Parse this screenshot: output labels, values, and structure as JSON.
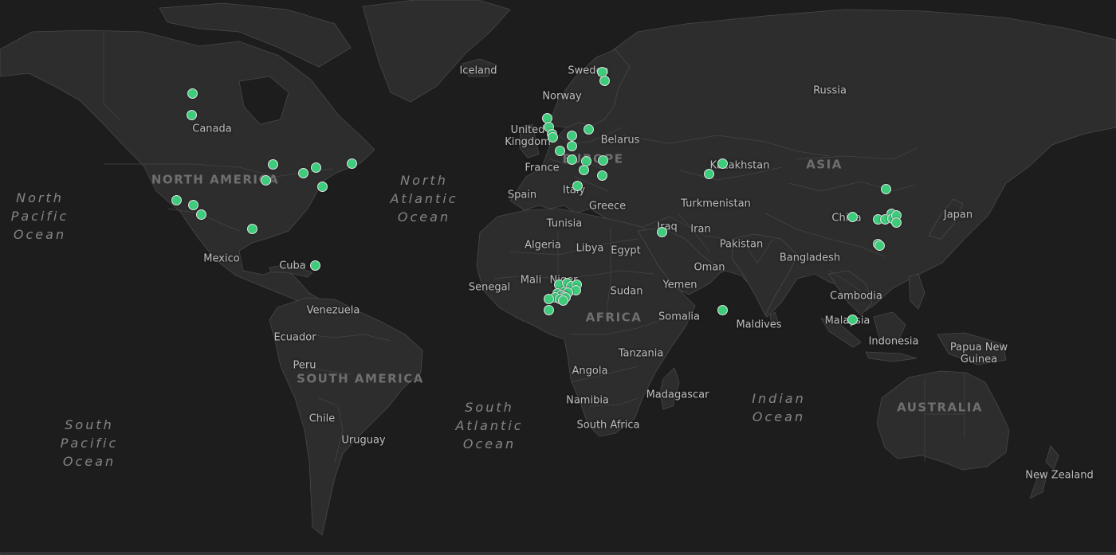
{
  "map": {
    "basemap": "dark",
    "colors": {
      "background": "#1d1d1d",
      "land": "#2d2d2d",
      "border": "#454545",
      "marker_fill": "#3ecb7c",
      "marker_stroke": "#e6e6e6"
    }
  },
  "labels": {
    "oceans": [
      {
        "id": "north-pacific",
        "text": "North\nPacific\nOcean"
      },
      {
        "id": "north-atlantic",
        "text": "North\nAtlantic\nOcean"
      },
      {
        "id": "south-atlantic",
        "text": "South\nAtlantic\nOcean"
      },
      {
        "id": "south-pacific",
        "text": "South\nPacific\nOcean"
      },
      {
        "id": "indian",
        "text": "Indian\nOcean"
      }
    ],
    "continents": [
      {
        "id": "north-america",
        "text": "NORTH\nAMERICA"
      },
      {
        "id": "south-america",
        "text": "SOUTH\nAMERICA"
      },
      {
        "id": "europe",
        "text": "EUROPE"
      },
      {
        "id": "africa",
        "text": "AFRICA"
      },
      {
        "id": "asia",
        "text": "ASIA"
      },
      {
        "id": "australia",
        "text": "AUSTRALIA"
      }
    ],
    "places": [
      {
        "id": "canada",
        "text": "Canada"
      },
      {
        "id": "mexico",
        "text": "Mexico"
      },
      {
        "id": "cuba",
        "text": "Cuba"
      },
      {
        "id": "venezuela",
        "text": "Venezuela"
      },
      {
        "id": "ecuador",
        "text": "Ecuador"
      },
      {
        "id": "peru",
        "text": "Peru"
      },
      {
        "id": "chile",
        "text": "Chile"
      },
      {
        "id": "uruguay",
        "text": "Uruguay"
      },
      {
        "id": "iceland",
        "text": "Iceland"
      },
      {
        "id": "sweden",
        "text": "Sweden"
      },
      {
        "id": "norway",
        "text": "Norway"
      },
      {
        "id": "united-kingdom",
        "text": "United\nKingdom"
      },
      {
        "id": "belarus",
        "text": "Belarus"
      },
      {
        "id": "france",
        "text": "France"
      },
      {
        "id": "spain",
        "text": "Spain"
      },
      {
        "id": "italy",
        "text": "Italy"
      },
      {
        "id": "greece",
        "text": "Greece"
      },
      {
        "id": "russia",
        "text": "Russia"
      },
      {
        "id": "kazakhstan",
        "text": "Kazakhstan"
      },
      {
        "id": "turkmenistan",
        "text": "Turkmenistan"
      },
      {
        "id": "iraq",
        "text": "Iraq"
      },
      {
        "id": "iran",
        "text": "Iran"
      },
      {
        "id": "pakistan",
        "text": "Pakistan"
      },
      {
        "id": "china",
        "text": "China"
      },
      {
        "id": "japan",
        "text": "Japan"
      },
      {
        "id": "bangladesh",
        "text": "Bangladesh"
      },
      {
        "id": "oman",
        "text": "Oman"
      },
      {
        "id": "yemen",
        "text": "Yemen"
      },
      {
        "id": "tunisia",
        "text": "Tunisia"
      },
      {
        "id": "algeria",
        "text": "Algeria"
      },
      {
        "id": "libya",
        "text": "Libya"
      },
      {
        "id": "egypt",
        "text": "Egypt"
      },
      {
        "id": "senegal",
        "text": "Senegal"
      },
      {
        "id": "mali",
        "text": "Mali"
      },
      {
        "id": "niger",
        "text": "Niger"
      },
      {
        "id": "sudan",
        "text": "Sudan"
      },
      {
        "id": "somalia",
        "text": "Somalia"
      },
      {
        "id": "tanzania",
        "text": "Tanzania"
      },
      {
        "id": "angola",
        "text": "Angola"
      },
      {
        "id": "namibia",
        "text": "Namibia"
      },
      {
        "id": "madagascar",
        "text": "Madagascar"
      },
      {
        "id": "south-africa",
        "text": "South Africa"
      },
      {
        "id": "maldives",
        "text": "Maldives"
      },
      {
        "id": "cambodia",
        "text": "Cambodia"
      },
      {
        "id": "malaysia",
        "text": "Malaysia"
      },
      {
        "id": "indonesia",
        "text": "Indonesia"
      },
      {
        "id": "papua-new-guinea",
        "text": "Papua New\nGuinea"
      },
      {
        "id": "new-zealand",
        "text": "New Zealand"
      }
    ]
  },
  "markers": [
    {
      "region": "north-america",
      "lon": -116.5,
      "lat": 60.3
    },
    {
      "region": "north-america",
      "lon": -116.7,
      "lat": 56.5
    },
    {
      "region": "north-america",
      "lon": -90.2,
      "lat": 46.2
    },
    {
      "region": "north-america",
      "lon": -92.6,
      "lat": 42.4
    },
    {
      "region": "north-america",
      "lon": -80.2,
      "lat": 44.1
    },
    {
      "region": "north-america",
      "lon": -76.1,
      "lat": 45.5
    },
    {
      "region": "north-america",
      "lon": -73.9,
      "lat": 40.7
    },
    {
      "region": "north-america",
      "lon": -64.4,
      "lat": 46.3
    },
    {
      "region": "north-america",
      "lon": -121.8,
      "lat": 37.3
    },
    {
      "region": "north-america",
      "lon": -116.4,
      "lat": 35.9
    },
    {
      "region": "north-america",
      "lon": -113.7,
      "lat": 33.4
    },
    {
      "region": "north-america",
      "lon": -96.9,
      "lat": 29.3
    },
    {
      "region": "north-america",
      "lon": -76.3,
      "lat": 17.9
    },
    {
      "region": "europe",
      "lon": -0.3,
      "lat": 55.9
    },
    {
      "region": "europe",
      "lon": 0.2,
      "lat": 54.2
    },
    {
      "region": "europe",
      "lon": 1.1,
      "lat": 52.7
    },
    {
      "region": "europe",
      "lon": 1.5,
      "lat": 52.1
    },
    {
      "region": "europe",
      "lon": 3.8,
      "lat": 49.2
    },
    {
      "region": "europe",
      "lon": 7.7,
      "lat": 52.4
    },
    {
      "region": "europe",
      "lon": 7.8,
      "lat": 50.2
    },
    {
      "region": "europe",
      "lon": 7.6,
      "lat": 47.3
    },
    {
      "region": "europe",
      "lon": 13.1,
      "lat": 53.7
    },
    {
      "region": "europe",
      "lon": 17.6,
      "lat": 63.6
    },
    {
      "region": "europe",
      "lon": 18.4,
      "lat": 62.3
    },
    {
      "region": "europe",
      "lon": 12.3,
      "lat": 47.0
    },
    {
      "region": "europe",
      "lon": 17.9,
      "lat": 47.2
    },
    {
      "region": "europe",
      "lon": 11.6,
      "lat": 44.9
    },
    {
      "region": "europe",
      "lon": 17.7,
      "lat": 43.6
    },
    {
      "region": "europe",
      "lon": 9.6,
      "lat": 41.0
    },
    {
      "region": "middle-east",
      "lon": 37.1,
      "lat": 28.4
    },
    {
      "region": "asia",
      "lon": 57.1,
      "lat": 46.4
    },
    {
      "region": "asia",
      "lon": 52.7,
      "lat": 43.9
    },
    {
      "region": "asia",
      "lon": 56.9,
      "lat": 3.4
    },
    {
      "region": "asia",
      "lon": 110.5,
      "lat": 40.2
    },
    {
      "region": "asia",
      "lon": 99.6,
      "lat": 32.7
    },
    {
      "region": "asia",
      "lon": 108.0,
      "lat": 31.9
    },
    {
      "region": "asia",
      "lon": 110.3,
      "lat": 32.1
    },
    {
      "region": "asia",
      "lon": 112.3,
      "lat": 33.5
    },
    {
      "region": "asia",
      "lon": 112.5,
      "lat": 32.3
    },
    {
      "region": "asia",
      "lon": 113.9,
      "lat": 33.1
    },
    {
      "region": "asia",
      "lon": 113.9,
      "lat": 31.0
    },
    {
      "region": "asia",
      "lon": 108.0,
      "lat": 24.6
    },
    {
      "region": "asia",
      "lon": 108.5,
      "lat": 24.3
    },
    {
      "region": "asia",
      "lon": 99.5,
      "lat": 0.2
    },
    {
      "region": "africa",
      "lon": 3.5,
      "lat": 11.9
    },
    {
      "region": "africa",
      "lon": 6.2,
      "lat": 12.3
    },
    {
      "region": "africa",
      "lon": 7.5,
      "lat": 11.2
    },
    {
      "region": "africa",
      "lon": 9.2,
      "lat": 11.9
    },
    {
      "region": "africa",
      "lon": 9.1,
      "lat": 10.0
    },
    {
      "region": "africa",
      "lon": 5.4,
      "lat": 9.4
    },
    {
      "region": "africa",
      "lon": 6.3,
      "lat": 9.2
    },
    {
      "region": "africa",
      "lon": 3.1,
      "lat": 8.9
    },
    {
      "region": "africa",
      "lon": 4.2,
      "lat": 8.4
    },
    {
      "region": "africa",
      "lon": 5.0,
      "lat": 8.0
    },
    {
      "region": "africa",
      "lon": 2.2,
      "lat": 7.6
    },
    {
      "region": "africa",
      "lon": 3.7,
      "lat": 7.2
    },
    {
      "region": "africa",
      "lon": 5.6,
      "lat": 7.5
    },
    {
      "region": "africa",
      "lon": 4.8,
      "lat": 6.6
    },
    {
      "region": "africa",
      "lon": 0.1,
      "lat": 7.2
    },
    {
      "region": "africa",
      "lon": 0.1,
      "lat": 3.3
    }
  ]
}
